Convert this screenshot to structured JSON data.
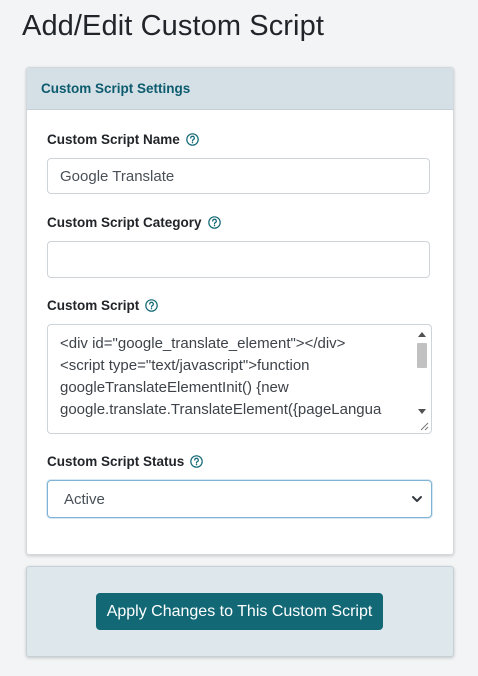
{
  "page": {
    "title": "Add/Edit Custom Script"
  },
  "settings_card": {
    "header": "Custom Script Settings",
    "name_field": {
      "label": "Custom Script Name",
      "value": "Google Translate",
      "help_icon": "question-circle-icon"
    },
    "category_field": {
      "label": "Custom Script Category",
      "value": "",
      "help_icon": "question-circle-icon"
    },
    "script_field": {
      "label": "Custom Script",
      "help_icon": "question-circle-icon",
      "value": "<div id=\"google_translate_element\"></div>\n<script type=\"text/javascript\">function\ngoogleTranslateElementInit() {new\ngoogle.translate.TranslateElement({pageLangua"
    },
    "status_field": {
      "label": "Custom Script Status",
      "selected": "Active",
      "help_icon": "question-circle-icon"
    }
  },
  "actions": {
    "apply_label": "Apply Changes to This Custom Script"
  },
  "colors": {
    "accent": "#136876",
    "header_bg": "#d4e0e6",
    "header_text": "#0d5b6e"
  }
}
